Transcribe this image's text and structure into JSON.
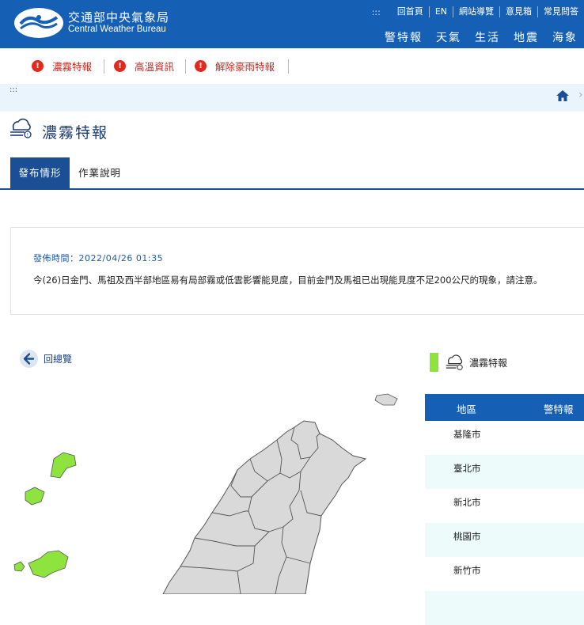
{
  "header": {
    "logo_zh": "交通部中央氣象局",
    "logo_en": "Central Weather Bureau",
    "util_dots": ":::",
    "util_links": [
      "回首頁",
      "EN",
      "網站導覽",
      "意見箱",
      "常見問答"
    ],
    "main_nav": [
      "警特報",
      "天氣",
      "生活",
      "地震",
      "海象"
    ]
  },
  "alerts": [
    "濃霧特報",
    "高溫資訊",
    "解除豪雨特報"
  ],
  "breadcrumb": {
    "dots": ":::",
    "home_icon": "home-icon"
  },
  "page": {
    "title": "濃霧特報",
    "tabs": [
      "發布情形",
      "作業說明"
    ]
  },
  "notice": {
    "time_label": "發佈時間：2022/04/26 01:35",
    "body": "今(26)日金門、馬祖及西半部地區易有局部霧或低雲影響能見度，目前金門及馬祖已出現能見度不足200公尺的現象，請注意。"
  },
  "back_label": "回總覽",
  "legend": {
    "label": "濃霧特報",
    "color": "#8fe33f"
  },
  "table": {
    "headers": [
      "地區",
      "警特報"
    ],
    "rows": [
      "基隆市",
      "臺北市",
      "新北市",
      "桃園市",
      "新竹市"
    ]
  },
  "colors": {
    "brand": "#1560b5",
    "alert": "#e02a20",
    "fog": "#8fe33f",
    "map_gray": "#d9d9d9"
  }
}
